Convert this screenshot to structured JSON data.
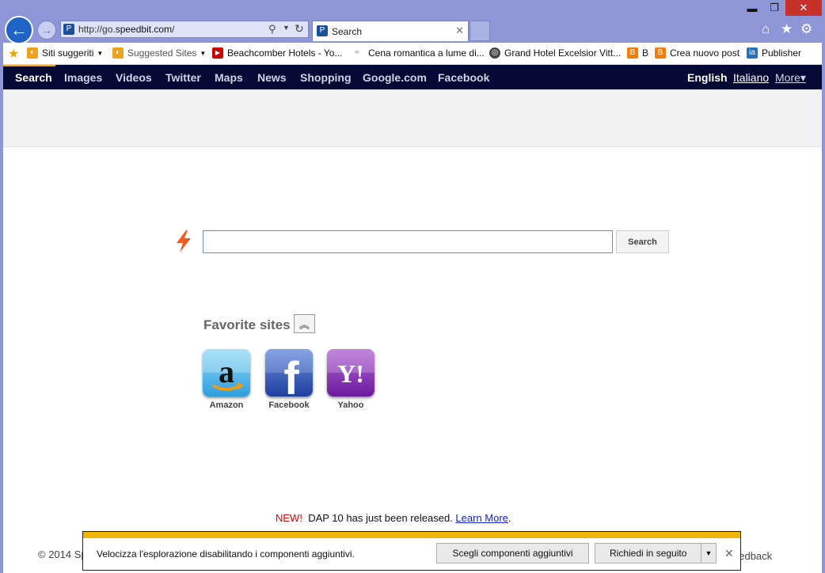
{
  "browser": {
    "url_prefix": "http://go.",
    "url_domain": "speedbit.com",
    "url_suffix": "/",
    "tab_title": "Search",
    "icons": [
      "back-icon",
      "forward-icon",
      "search-icon",
      "refresh-icon",
      "home-icon",
      "star-icon",
      "gear-icon",
      "close-icon"
    ]
  },
  "favorites_bar": {
    "items": [
      {
        "label": "Siti suggeriti",
        "icon": "suggested-sites-icon",
        "dropdown": true
      },
      {
        "label": "Suggested Sites",
        "icon": "suggested-sites-icon",
        "dropdown": true
      },
      {
        "label": "Beachcomber Hotels - Yo...",
        "icon": "youtube-icon"
      },
      {
        "label": "Cena romantica a lume di...",
        "icon": "site-icon"
      },
      {
        "label": "Grand Hotel Excelsior Vitt...",
        "icon": "site-icon"
      },
      {
        "label": "B",
        "icon": "blogger-icon"
      },
      {
        "label": "Crea nuovo post",
        "icon": "blogger-icon"
      },
      {
        "label": "Publisher",
        "icon": "publisher-icon"
      }
    ]
  },
  "site_nav": {
    "items": [
      "Search",
      "Images",
      "Videos",
      "Twitter",
      "Maps",
      "News",
      "Shopping",
      "Google.com",
      "Facebook"
    ],
    "active": "Search",
    "languages": [
      "English",
      "Italiano"
    ],
    "more_label": "More▾"
  },
  "search": {
    "button_label": "Search",
    "input_value": ""
  },
  "favorites": {
    "title": "Favorite sites",
    "sites": [
      {
        "name": "Amazon"
      },
      {
        "name": "Facebook"
      },
      {
        "name": "Yahoo"
      }
    ]
  },
  "notice": {
    "new_label": "NEW!",
    "text": "DAP 10 has just been released.",
    "link": "Learn More",
    "period": "."
  },
  "footer": {
    "copyright": "© 2014 Sp",
    "feedback": "eedback"
  },
  "notification": {
    "message": "Velocizza l'esplorazione disabilitando i componenti aggiuntivi.",
    "primary_button": "Scegli componenti aggiuntivi",
    "secondary_button": "Richiedi in seguito"
  },
  "colors": {
    "frame": "#8e96d7",
    "nav_background": "#040a33",
    "nav_accent": "#f3a51d",
    "notification_bar": "#f2b600",
    "new_label": "#e20000",
    "link": "#1222d8"
  }
}
